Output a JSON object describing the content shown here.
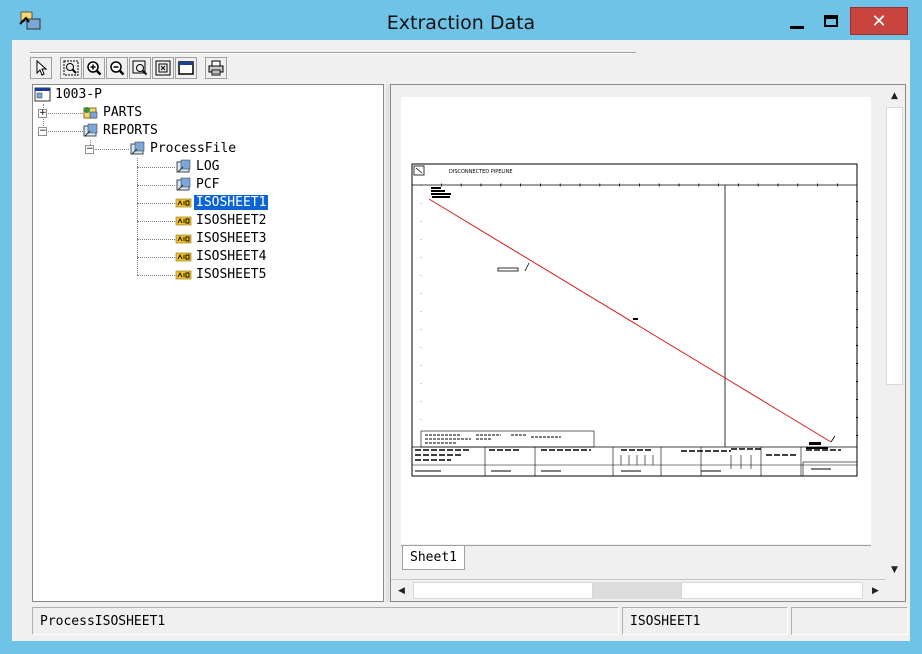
{
  "window": {
    "title": "Extraction Data",
    "close_glyph": "✕"
  },
  "toolbar": {
    "buttons": [
      {
        "name": "select-pointer-icon"
      },
      {
        "name": "zoom-area-icon"
      },
      {
        "name": "zoom-in-icon"
      },
      {
        "name": "zoom-out-icon"
      },
      {
        "name": "zoom-previous-icon"
      },
      {
        "name": "zoom-fit-icon"
      },
      {
        "name": "zoom-window-icon"
      },
      {
        "name": "print-icon"
      }
    ]
  },
  "tree": {
    "root": "1003-P",
    "parts": "PARTS",
    "reports": "REPORTS",
    "process_file": "ProcessFile",
    "log": "LOG",
    "pcf": "PCF",
    "iso1": "ISOSHEET1",
    "iso2": "ISOSHEET2",
    "iso3": "ISOSHEET3",
    "iso4": "ISOSHEET4",
    "iso5": "ISOSHEET5",
    "expand_plus": "+",
    "expand_minus": "−"
  },
  "viewer": {
    "drawing_title": "DISCONNECTED PIPELINE",
    "sheet_tab": "Sheet1"
  },
  "status": {
    "left": "ProcessISOSHEET1",
    "middle": "ISOSHEET1",
    "right": ""
  },
  "colors": {
    "selection": "#0a64d6",
    "pipeline": "#d42020",
    "titlebar": "#6fc3e6",
    "close": "#c9433f"
  }
}
